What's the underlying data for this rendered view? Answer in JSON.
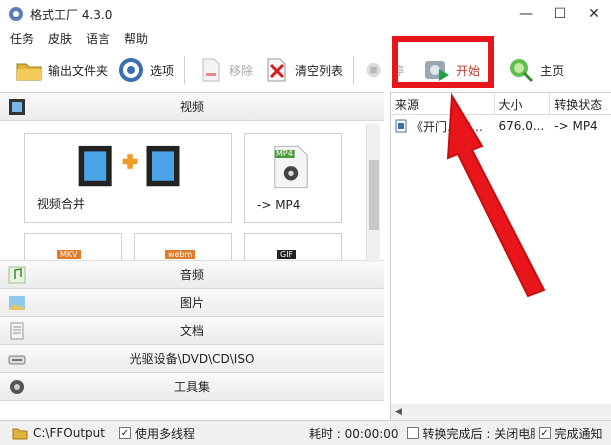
{
  "window": {
    "title": "格式工厂 4.3.0",
    "minimize": "—",
    "maximize": "☐",
    "close": "✕"
  },
  "menu": [
    "任务",
    "皮肤",
    "语言",
    "帮助"
  ],
  "toolbar": {
    "output_folder": "输出文件夹",
    "options": "选项",
    "remove": "移除",
    "clear_list": "清空列表",
    "stop": "停",
    "start": "开始",
    "home": "主页"
  },
  "categories": {
    "video": "视频",
    "audio": "音频",
    "picture": "图片",
    "document": "文档",
    "optical": "光驱设备\\DVD\\CD\\ISO",
    "tools": "工具集"
  },
  "tiles": {
    "merge_label": "视频合并",
    "mp4_label": "-> MP4",
    "mp4_badge": "MP4",
    "mkv_badge": "MKV",
    "webm_badge": "webm",
    "gif_badge": "GIF"
  },
  "file_list": {
    "headers": [
      "来源",
      "大小",
      "转换状态"
    ],
    "rows": [
      {
        "source": "《开门…吉…",
        "size": "676.0...",
        "status": "-> MP4"
      }
    ]
  },
  "statusbar": {
    "output_path": "C:\\FFOutput",
    "multithread": "使用多线程",
    "elapsed": "耗时 : 00:00:00",
    "after_convert": "转换完成后 : 关闭电脑",
    "notify": "完成通知"
  },
  "colors": {
    "highlight": "#e8161a",
    "start_text": "#c0392b"
  }
}
